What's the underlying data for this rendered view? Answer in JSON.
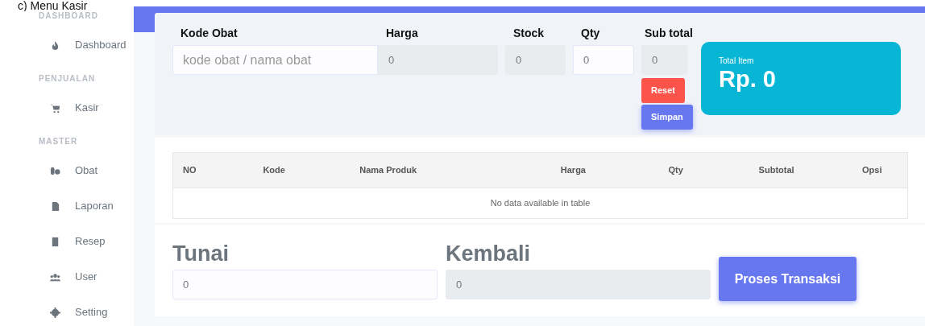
{
  "caption": "c) Menu Kasir",
  "sidebar": {
    "sections": [
      {
        "heading": "DASHBOARD",
        "items": [
          {
            "label": "Dashboard"
          }
        ]
      },
      {
        "heading": "PENJUALAN",
        "items": [
          {
            "label": "Kasir"
          }
        ]
      },
      {
        "heading": "MASTER",
        "items": [
          {
            "label": "Obat"
          },
          {
            "label": "Laporan"
          },
          {
            "label": "Resep"
          },
          {
            "label": "User"
          },
          {
            "label": "Setting"
          }
        ]
      }
    ]
  },
  "entry": {
    "fields": [
      {
        "label": "Kode Obat",
        "placeholder": "kode obat / nama obat",
        "kind": "select"
      },
      {
        "label": "Harga",
        "value": "0",
        "kind": "readonly"
      },
      {
        "label": "Stock",
        "value": "0",
        "kind": "readonly"
      },
      {
        "label": "Qty",
        "value": "0",
        "kind": "input"
      },
      {
        "label": "Sub total",
        "value": "0",
        "kind": "readonly"
      }
    ],
    "buttons": [
      {
        "label": "Reset",
        "kind": "danger"
      },
      {
        "label": "Simpan",
        "kind": "primary"
      }
    ]
  },
  "total_card": {
    "label": "Total Item",
    "value": "Rp. 0"
  },
  "table": {
    "columns": [
      "NO",
      "Kode",
      "Nama Produk",
      "Harga",
      "Qty",
      "Subtotal",
      "Opsi"
    ],
    "empty_message": "No data available in table"
  },
  "payment": {
    "fields": [
      {
        "label": "Tunai",
        "value": "0",
        "kind": "input"
      },
      {
        "label": "Kembali",
        "value": "0",
        "kind": "readonly"
      }
    ],
    "button": "Proses Transaksi"
  }
}
